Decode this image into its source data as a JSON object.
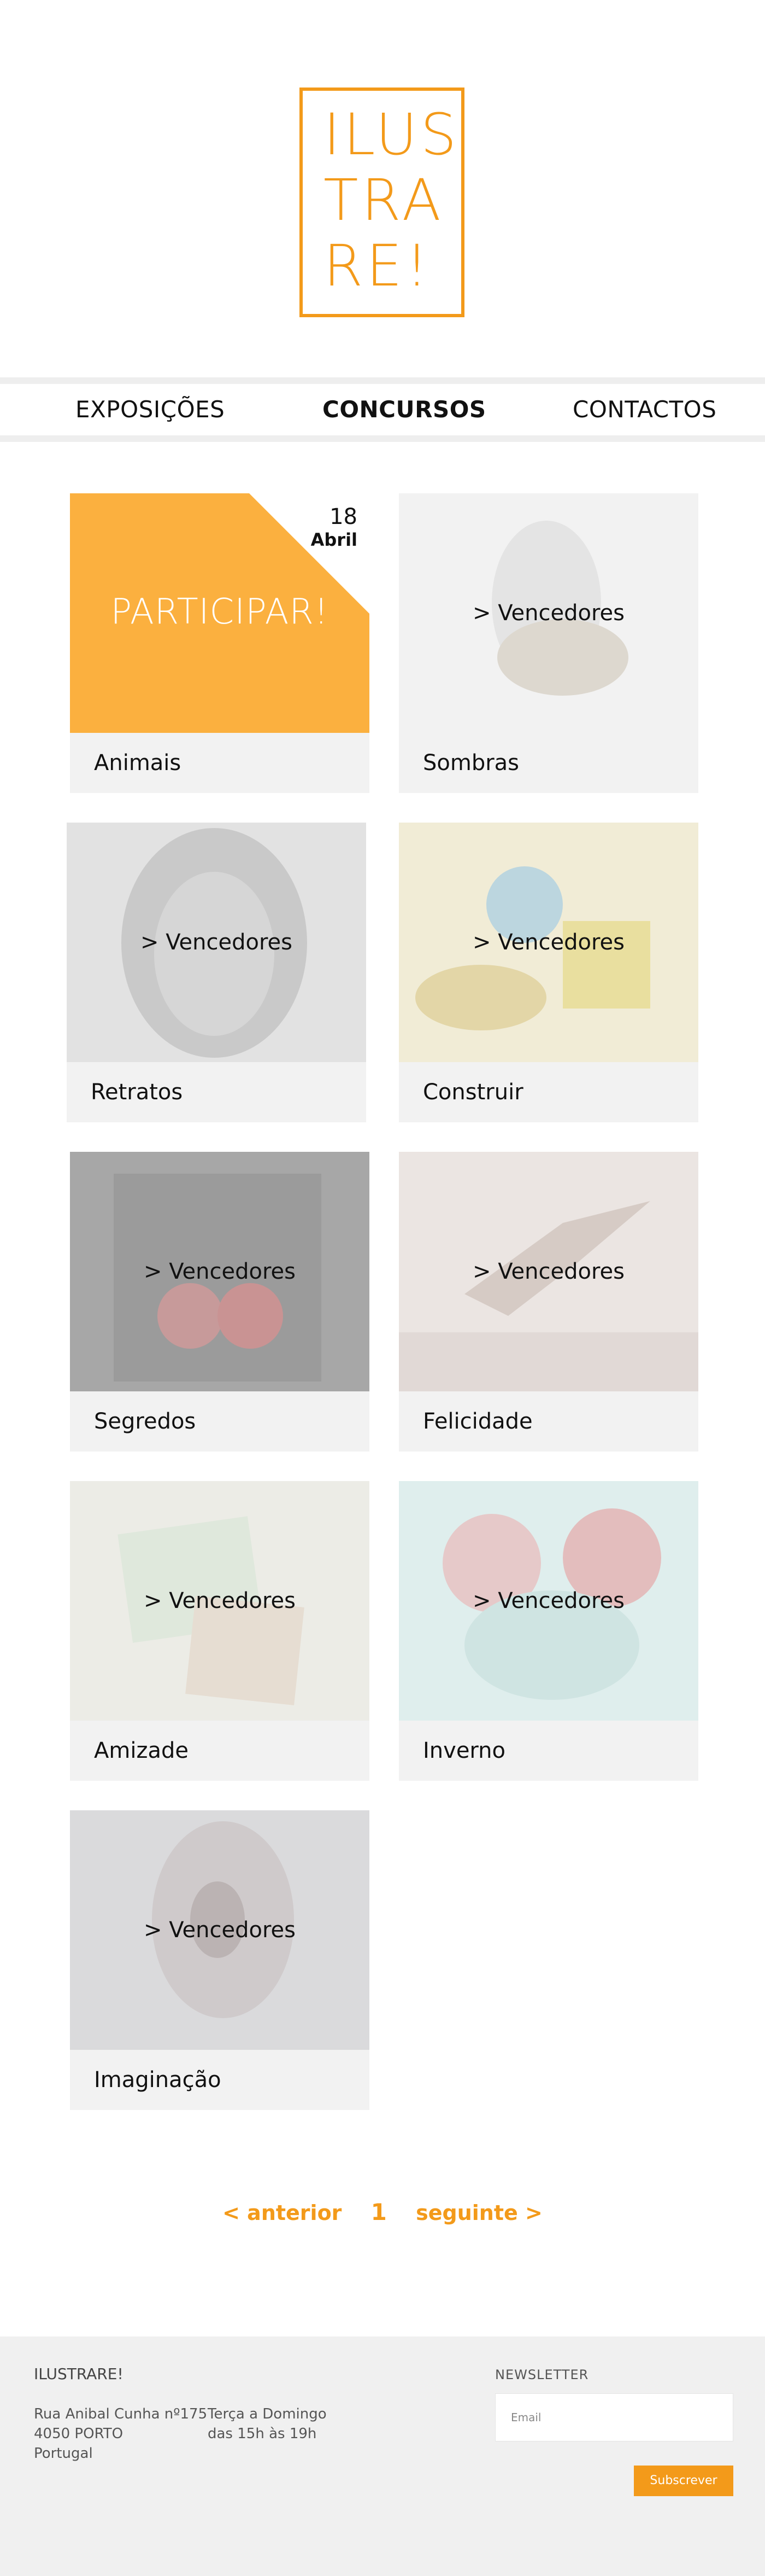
{
  "logo": {
    "lines": [
      "ILUS",
      "TRA",
      "RE!"
    ]
  },
  "nav": {
    "items": [
      "EXPOSIÇÕES",
      "CONCURSOS",
      "CONTACTOS"
    ],
    "active": "CONCURSOS"
  },
  "cards": [
    {
      "title": "Animais",
      "featured": {
        "day": "18",
        "month": "Abril",
        "cta": "PARTICIPAR!"
      }
    },
    {
      "title": "Sombras",
      "link": "> Vencedores",
      "image_tint": "#eeeeee"
    },
    {
      "title": "Retratos",
      "link": "> Vencedores",
      "image_tint": "#dcdcdc"
    },
    {
      "title": "Construir",
      "link": "> Vencedores",
      "image_tint": "#ede6c4"
    },
    {
      "title": "Segredos",
      "link": "> Vencedores",
      "image_tint": "#a9a9a9"
    },
    {
      "title": "Felicidade",
      "link": "> Vencedores",
      "image_tint": "#e6dedb"
    },
    {
      "title": "Amizade",
      "link": "> Vencedores",
      "image_tint": "#e7e7e0"
    },
    {
      "title": "Inverno",
      "link": "> Vencedores",
      "image_tint": "#dcebe8"
    },
    {
      "title": "Imaginação",
      "link": "> Vencedores",
      "image_tint": "#d5d5d8"
    }
  ],
  "pagination": {
    "prev": "< anterior",
    "page": "1",
    "next": "seguinte >"
  },
  "footer": {
    "brand": "ILUSTRARE!",
    "address": [
      "Rua Anibal Cunha nº175",
      "4050 PORTO",
      "Portugal"
    ],
    "hours": [
      "Terça a Domingo",
      "das 15h às 19h"
    ],
    "newsletter_label": "NEWSLETTER",
    "email_placeholder": "Email",
    "subscribe_label": "Subscrever"
  },
  "colors": {
    "accent": "#f39a1a",
    "participate_bg": "#fbb03f",
    "card_bg": "#f2f2f2",
    "footer_bg": "#f0f0f0"
  }
}
